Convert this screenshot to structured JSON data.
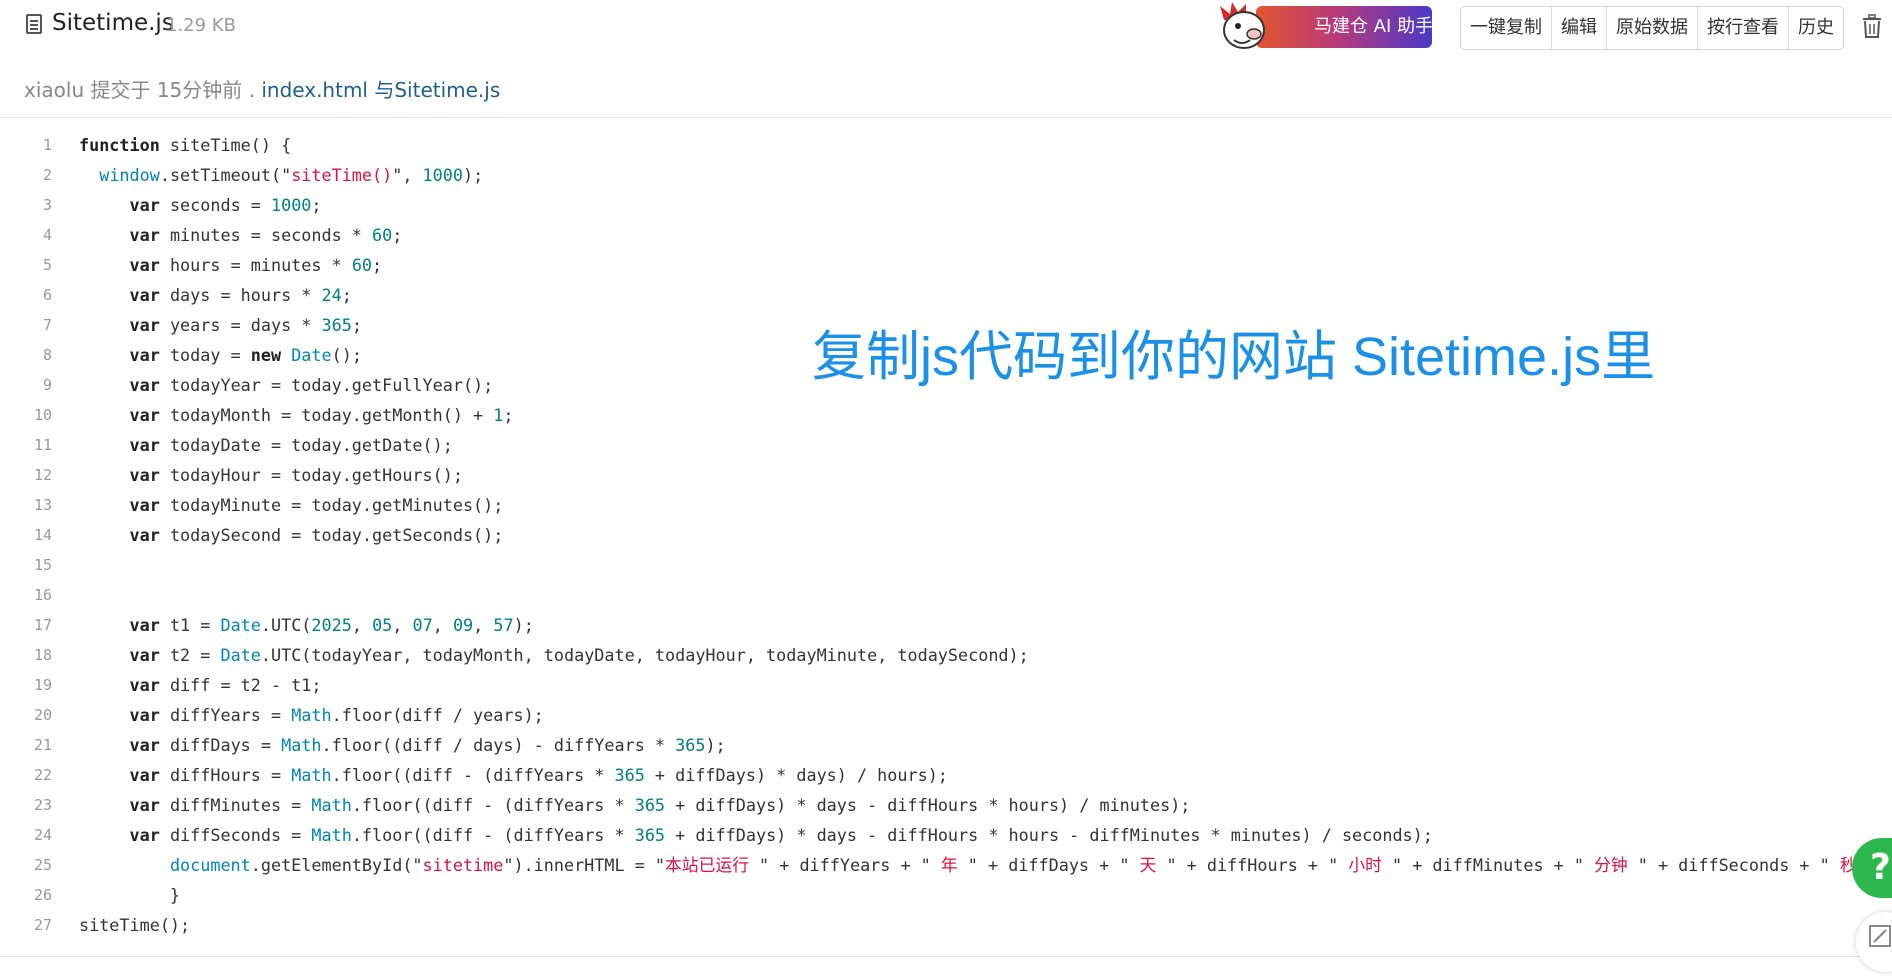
{
  "file": {
    "name": "Sitetime.js",
    "size": "1.29 KB"
  },
  "commit": {
    "prefix": "xiaolu 提交于 15分钟前 .",
    "message": "index.html 与Sitetime.js"
  },
  "ai_assistant": {
    "label": "马建仓 AI 助手",
    "icon": "mascot-icon"
  },
  "toolbar": {
    "copy": "一键复制",
    "edit": "编辑",
    "raw": "原始数据",
    "blame": "按行查看",
    "history": "历史"
  },
  "overlay_text": "复制js代码到你的网站 Sitetime.js里",
  "help_button": "?",
  "colors": {
    "keyword": "#222222",
    "builtin": "#0086b3",
    "number": "#008080",
    "string": "#dd1144",
    "line_number": "#999999",
    "overlay": "#1a90e8",
    "help": "#2db84d"
  },
  "code_lines": [
    "function siteTime() {",
    "  window.setTimeout(\"siteTime()\", 1000);",
    "     var seconds = 1000;",
    "     var minutes = seconds * 60;",
    "     var hours = minutes * 60;",
    "     var days = hours * 24;",
    "     var years = days * 365;",
    "     var today = new Date();",
    "     var todayYear = today.getFullYear();",
    "     var todayMonth = today.getMonth() + 1;",
    "     var todayDate = today.getDate();",
    "     var todayHour = today.getHours();",
    "     var todayMinute = today.getMinutes();",
    "     var todaySecond = today.getSeconds();",
    "",
    "",
    "     var t1 = Date.UTC(2025, 05, 07, 09, 57);",
    "     var t2 = Date.UTC(todayYear, todayMonth, todayDate, todayHour, todayMinute, todaySecond);",
    "     var diff = t2 - t1;",
    "     var diffYears = Math.floor(diff / years);",
    "     var diffDays = Math.floor((diff / days) - diffYears * 365);",
    "     var diffHours = Math.floor((diff - (diffYears * 365 + diffDays) * days) / hours);",
    "     var diffMinutes = Math.floor((diff - (diffYears * 365 + diffDays) * days - diffHours * hours) / minutes);",
    "     var diffSeconds = Math.floor((diff - (diffYears * 365 + diffDays) * days - diffHours * hours - diffMinutes * minutes) / seconds);",
    "         document.getElementById(\"sitetime\").innerHTML = \"本站已运行 \" + diffYears + \" 年 \" + diffDays + \" 天 \" + diffHours + \" 小时 \" + diffMinutes + \" 分钟 \" + diffSeconds + \" 秒\";",
    "         }",
    "siteTime();"
  ]
}
